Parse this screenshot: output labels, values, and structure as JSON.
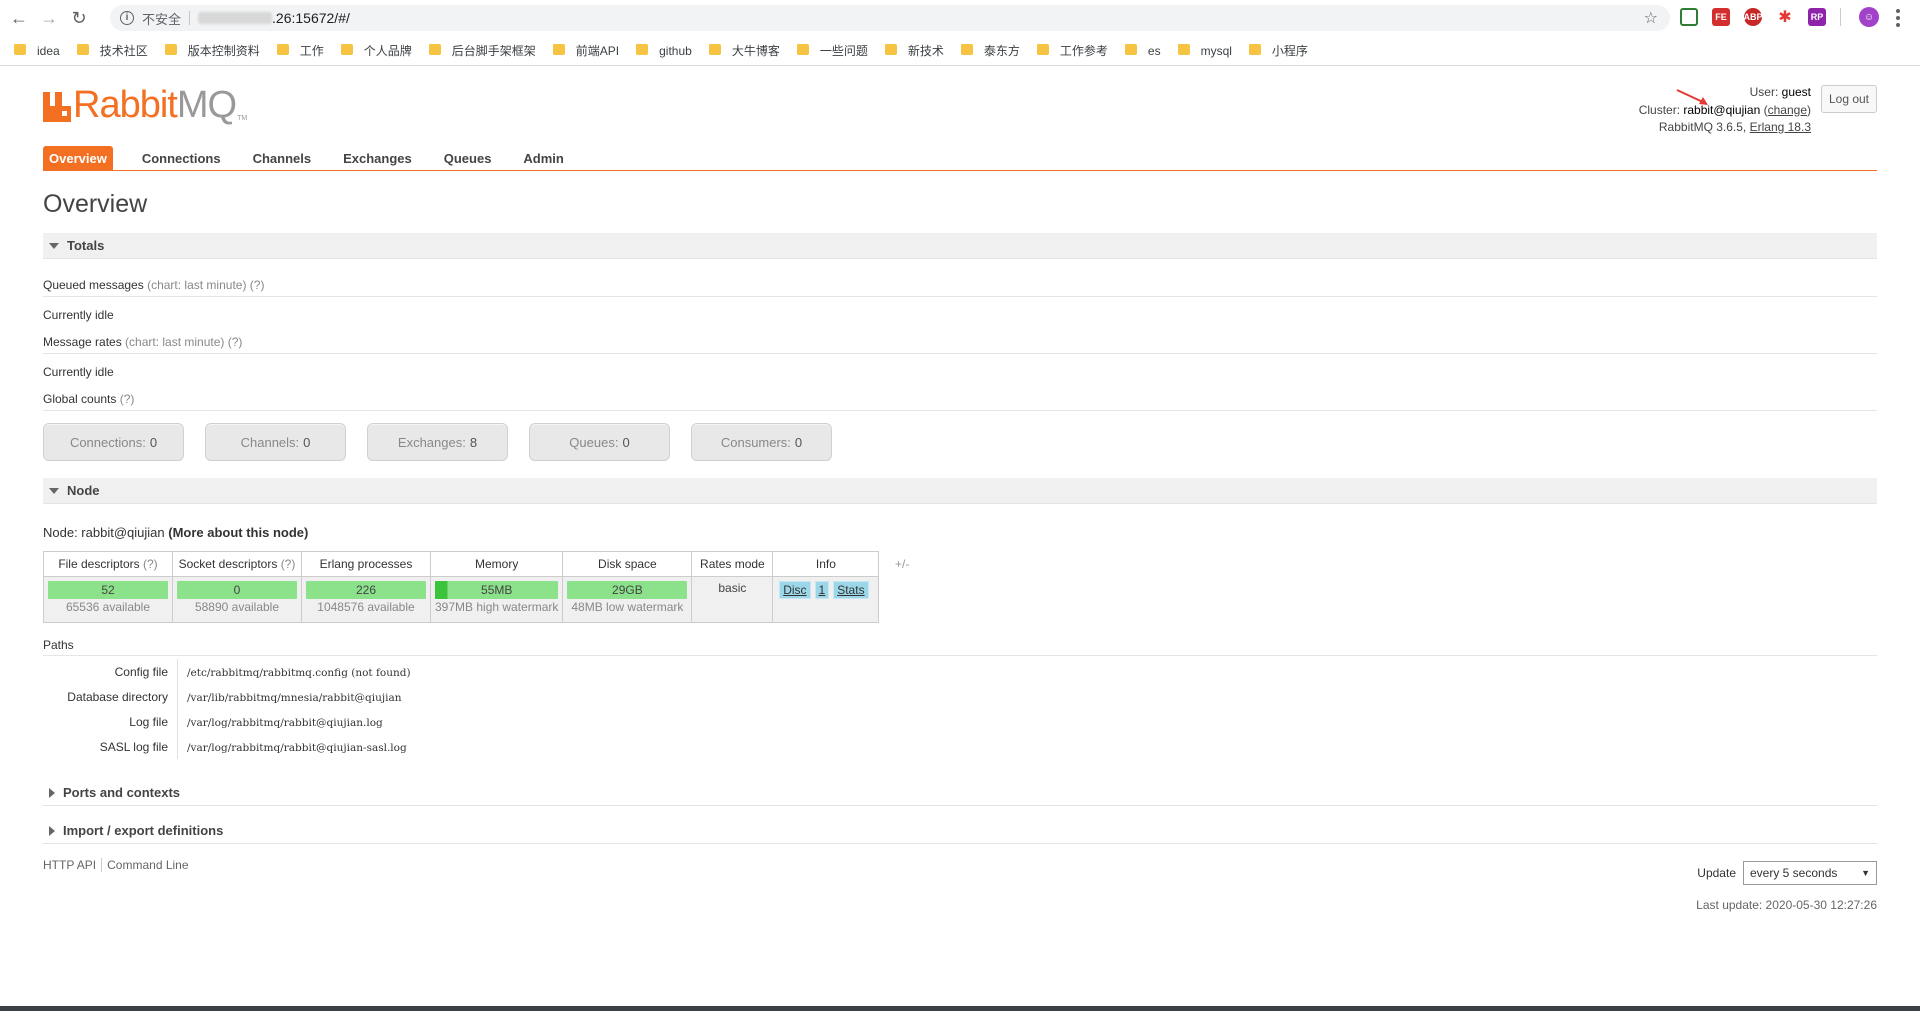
{
  "browser": {
    "insecure_label": "不安全",
    "url": ".26:15672/#/",
    "bookmarks": [
      "idea",
      "技术社区",
      "版本控制资料",
      "工作",
      "个人品牌",
      "后台脚手架框架",
      "前端API",
      "github",
      "大牛博客",
      "一些问题",
      "新技术",
      "泰东方",
      "工作参考",
      "es",
      "mysql",
      "小程序"
    ]
  },
  "logo": {
    "rabbit": "Rabbit",
    "mq": "MQ",
    "tm": "TM"
  },
  "header": {
    "user_label": "User:",
    "user": "guest",
    "cluster_label": "Cluster:",
    "cluster": "rabbit@qiujian",
    "change": "change",
    "version": "RabbitMQ 3.6.5,",
    "erlang": "Erlang 18.3",
    "logout": "Log out"
  },
  "tabs": [
    "Overview",
    "Connections",
    "Channels",
    "Exchanges",
    "Queues",
    "Admin"
  ],
  "title": "Overview",
  "totals": {
    "heading": "Totals",
    "queued_label": "Queued messages",
    "queued_hint": "(chart: last minute) (?)",
    "queued_state": "Currently idle",
    "rates_label": "Message rates",
    "rates_hint": "(chart: last minute) (?)",
    "rates_state": "Currently idle",
    "global_label": "Global counts",
    "global_hint": "(?)",
    "counts": [
      {
        "label": "Connections:",
        "value": "0"
      },
      {
        "label": "Channels:",
        "value": "0"
      },
      {
        "label": "Exchanges:",
        "value": "8"
      },
      {
        "label": "Queues:",
        "value": "0"
      },
      {
        "label": "Consumers:",
        "value": "0"
      }
    ]
  },
  "node": {
    "heading": "Node",
    "node_label": "Node: rabbit@qiujian",
    "more_link": "(More about this node)",
    "headers": [
      "File descriptors",
      "Socket descriptors",
      "Erlang processes",
      "Memory",
      "Disk space",
      "Rates mode",
      "Info"
    ],
    "hint": "(?)",
    "file_desc": {
      "value": "52",
      "sub": "65536 available"
    },
    "socket_desc": {
      "value": "0",
      "sub": "58890 available"
    },
    "erlang_proc": {
      "value": "226",
      "sub": "1048576 available"
    },
    "memory": {
      "value": "55MB",
      "sub": "397MB high watermark"
    },
    "disk": {
      "value": "29GB",
      "sub": "48MB low watermark"
    },
    "rates_mode": "basic",
    "info_buttons": [
      "Disc",
      "1",
      "Stats"
    ],
    "plusminus": "+/-"
  },
  "paths": {
    "heading": "Paths",
    "rows": [
      {
        "k": "Config file",
        "v": "/etc/rabbitmq/rabbitmq.config (not found)"
      },
      {
        "k": "Database directory",
        "v": "/var/lib/rabbitmq/mnesia/rabbit@qiujian"
      },
      {
        "k": "Log file",
        "v": "/var/log/rabbitmq/rabbit@qiujian.log"
      },
      {
        "k": "SASL log file",
        "v": "/var/log/rabbitmq/rabbit@qiujian-sasl.log"
      }
    ]
  },
  "collapsed_sections": [
    "Ports and contexts",
    "Import / export definitions"
  ],
  "footer": {
    "http_api": "HTTP API",
    "command_line": "Command Line",
    "update_label": "Update",
    "update_value": "every 5 seconds",
    "last_update": "Last update: 2020-05-30 12:27:26"
  },
  "colors": {
    "accent": "#f36f21",
    "bar_green": "#8be28b",
    "info_blue": "#9bd7e8"
  }
}
